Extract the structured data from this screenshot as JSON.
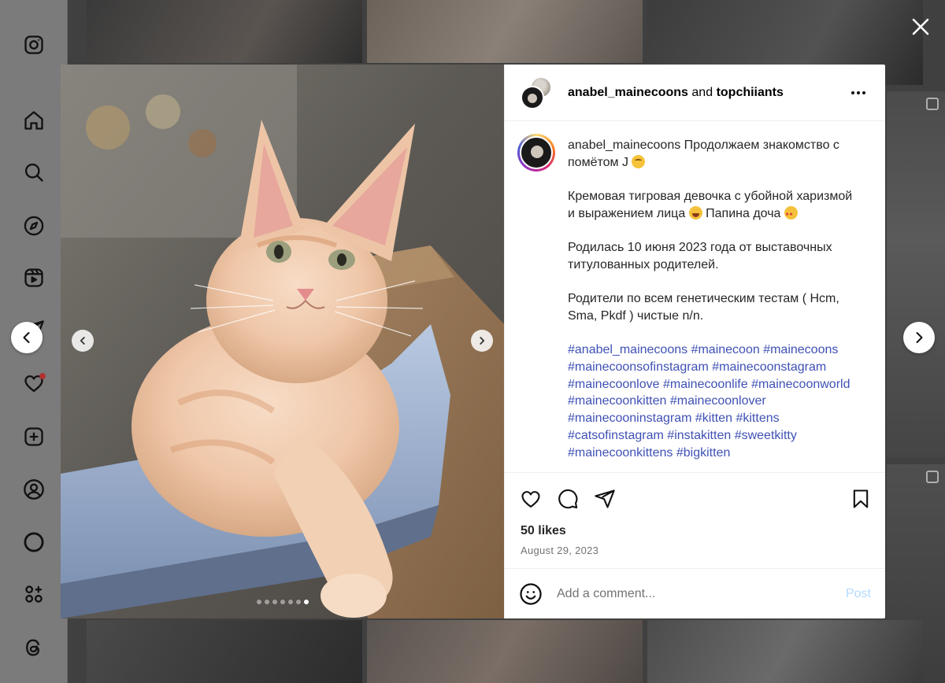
{
  "sidebar": {
    "items": [
      {
        "name": "instagram-logo-icon"
      },
      {
        "name": "home-icon"
      },
      {
        "name": "search-icon"
      },
      {
        "name": "explore-icon"
      },
      {
        "name": "reels-icon"
      },
      {
        "name": "messages-icon"
      },
      {
        "name": "notifications-icon"
      },
      {
        "name": "create-icon"
      },
      {
        "name": "profile-icon"
      },
      {
        "name": "threads-ring-icon"
      },
      {
        "name": "more-apps-icon"
      },
      {
        "name": "threads-icon"
      }
    ],
    "notification_color": "#b0312f"
  },
  "post": {
    "header": {
      "author": "anabel_mainecoons",
      "joiner": "and",
      "collaborator": "topchiiants"
    },
    "caption": {
      "username": "anabel_mainecoons",
      "line1": "Продолжаем знакомство с помётом J",
      "paragraph2": "Кремовая тигровая девочка с убойной харизмой и выражением лица",
      "paragraph2_tail": "Папина доча",
      "paragraph3": "Родилась 10 июня 2023 года от выставочных титулованных родителей.",
      "paragraph4": "Родители по всем генетическим тестам ( Hcm, Sma, Pkdf ) чистые n/n.",
      "hashtags": [
        "#anabel_mainecoons",
        "#mainecoon",
        "#mainecoons",
        "#mainecoonsofinstagram",
        "#mainecoonstagram",
        "#mainecoonlove",
        "#mainecoonlife",
        "#mainecoonworld",
        "#mainecoonkitten",
        "#mainecoonlover",
        "#mainecooninstagram",
        "#kitten",
        "#kittens",
        "#catsofinstagram",
        "#instakitten",
        "#sweetkitty",
        "#mainecoonkittens",
        "#bigkitten"
      ]
    },
    "likes": "50 likes",
    "date": "August 29, 2023",
    "comment_placeholder": "Add a comment...",
    "post_label": "Post",
    "carousel": {
      "count": 7,
      "active_index": 6
    }
  },
  "colors": {
    "hashtag": "#3f51b5",
    "post_button": "#b3dbff",
    "meta_text": "#737373"
  }
}
